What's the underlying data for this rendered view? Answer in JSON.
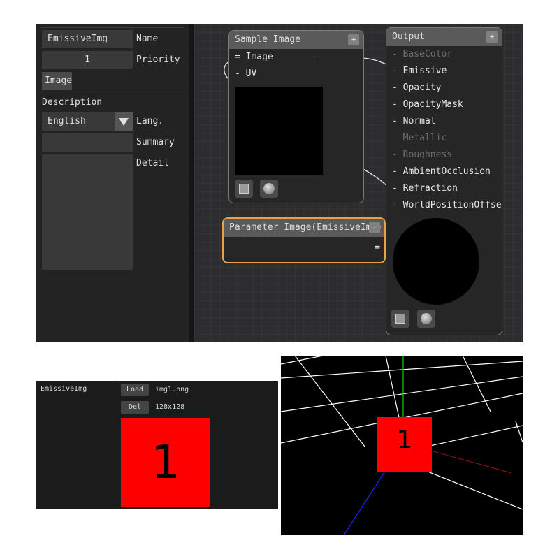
{
  "params": {
    "name_value": "EmissiveImg",
    "name_label": "Name",
    "priority_value": "1",
    "priority_label": "Priority",
    "type_tag": "Image",
    "description_label": "Description",
    "language_value": "English",
    "language_label": "Lang.",
    "summary_label": "Summary",
    "detail_label": "Detail"
  },
  "nodes": {
    "sample_image": {
      "title": "Sample Image",
      "plus": "+",
      "input_pins": [
        "= Image",
        "- UV"
      ],
      "output_pin": "-"
    },
    "output": {
      "title": "Output",
      "plus": "+",
      "pins": [
        {
          "label": "- BaseColor",
          "enabled": false
        },
        {
          "label": "- Emissive",
          "enabled": true
        },
        {
          "label": "- Opacity",
          "enabled": true
        },
        {
          "label": "- OpacityMask",
          "enabled": true
        },
        {
          "label": "- Normal",
          "enabled": true
        },
        {
          "label": "- Metallic",
          "enabled": false
        },
        {
          "label": "- Roughness",
          "enabled": false
        },
        {
          "label": "- AmbientOcclusion",
          "enabled": true
        },
        {
          "label": "- Refraction",
          "enabled": true
        },
        {
          "label": "- WorldPositionOffset",
          "enabled": true
        }
      ]
    },
    "parameter_image": {
      "title": "Parameter Image(EmissiveImg)",
      "minus": "-",
      "output_pin": "="
    }
  },
  "image_panel": {
    "param_name": "EmissiveImg",
    "load_label": "Load",
    "del_label": "Del",
    "file_name": "img1.png",
    "file_size": "128x128",
    "texture_glyph": "1"
  },
  "viewport": {
    "texture_glyph": "1"
  },
  "colors": {
    "accent_selected": "#e2a44a",
    "texture_red": "#ff0000",
    "axis_y": "#00c800",
    "axis_z": "#2020ff",
    "axis_x": "#ff2020"
  }
}
